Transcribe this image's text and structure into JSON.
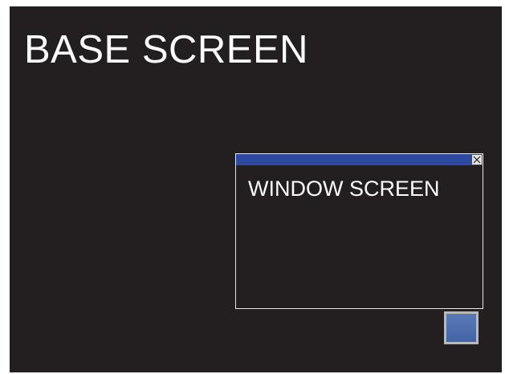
{
  "base_screen": {
    "title": "BASE SCREEN",
    "background_color": "#231f20",
    "button": {
      "icon": "square-button",
      "color": "#4a6bb0"
    }
  },
  "window_screen": {
    "title": "WINDOW SCREEN",
    "titlebar_color": "#2e4aa0",
    "close_icon": "close-icon"
  }
}
